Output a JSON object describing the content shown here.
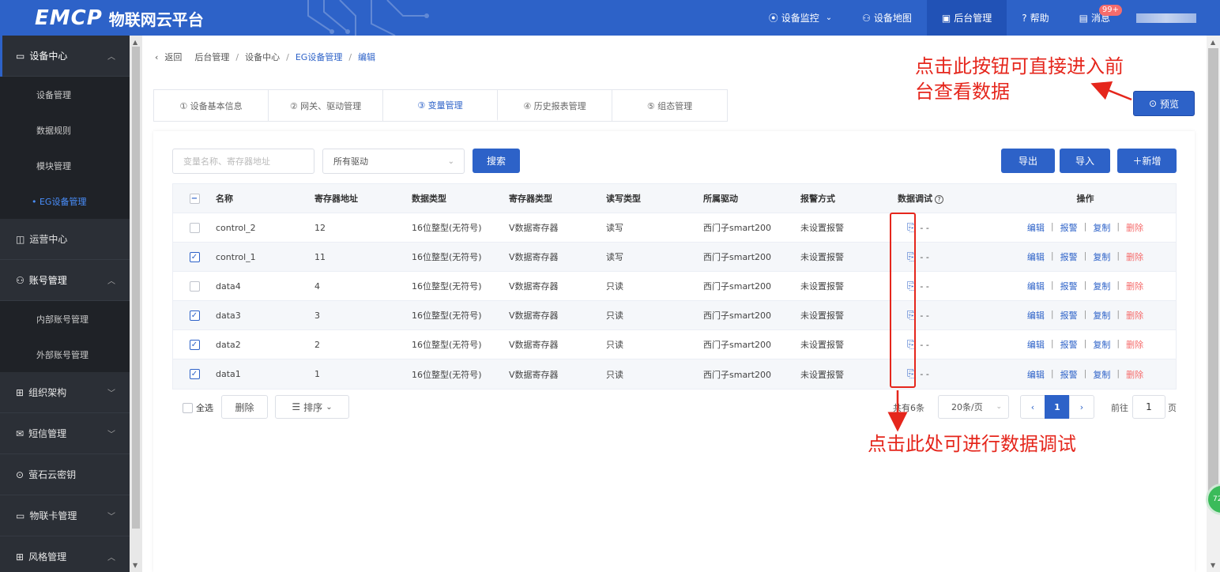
{
  "header": {
    "logo_mark": "EMCP",
    "logo_text": "物联网云平台",
    "nav": [
      {
        "icon": "location-icon",
        "label": "设备监控",
        "has_dropdown": true
      },
      {
        "icon": "user-icon",
        "label": "设备地图"
      },
      {
        "icon": "monitor-icon",
        "label": "后台管理",
        "active": true
      },
      {
        "icon": "help-icon",
        "label": "帮助"
      },
      {
        "icon": "message-icon",
        "label": "消息",
        "badge": "99+"
      }
    ]
  },
  "sidebar": {
    "groups": [
      {
        "label": "设备中心",
        "open": true,
        "items": [
          {
            "label": "设备管理"
          },
          {
            "label": "数据规则"
          },
          {
            "label": "模块管理"
          },
          {
            "label": "• EG设备管理",
            "active": true
          }
        ]
      },
      {
        "label": "运营中心"
      },
      {
        "label": "账号管理",
        "open": true,
        "items": [
          {
            "label": "内部账号管理"
          },
          {
            "label": "外部账号管理"
          }
        ]
      },
      {
        "label": "组织架构"
      },
      {
        "label": "短信管理"
      },
      {
        "label": "萤石云密钥"
      },
      {
        "label": "物联卡管理"
      },
      {
        "label": "风格管理"
      }
    ]
  },
  "breadcrumb": {
    "back": "返回",
    "items": [
      "后台管理",
      "设备中心",
      "EG设备管理",
      "编辑"
    ]
  },
  "tabs": [
    {
      "label": "① 设备基本信息"
    },
    {
      "label": "② 网关、驱动管理"
    },
    {
      "label": "③ 变量管理",
      "active": true
    },
    {
      "label": "④ 历史报表管理"
    },
    {
      "label": "⑤ 组态管理"
    }
  ],
  "preview_label": "预览",
  "toolbar": {
    "search_placeholder": "变量名称、寄存器地址",
    "driver_select": "所有驱动",
    "search_label": "搜索",
    "export_label": "导出",
    "import_label": "导入",
    "add_label": "＋新增"
  },
  "table": {
    "columns": [
      "名称",
      "寄存器地址",
      "数据类型",
      "寄存器类型",
      "读写类型",
      "所属驱动",
      "报警方式",
      "数据调试",
      "操作"
    ],
    "rows": [
      {
        "checked": false,
        "name": "control_2",
        "addr": "12",
        "dtype": "16位整型(无符号)",
        "rtype": "V数据寄存器",
        "rw": "读写",
        "driver": "西门子smart200",
        "alarm": "未设置报警",
        "debug": "- -"
      },
      {
        "checked": true,
        "name": "control_1",
        "addr": "11",
        "dtype": "16位整型(无符号)",
        "rtype": "V数据寄存器",
        "rw": "读写",
        "driver": "西门子smart200",
        "alarm": "未设置报警",
        "debug": "- -"
      },
      {
        "checked": false,
        "name": "data4",
        "addr": "4",
        "dtype": "16位整型(无符号)",
        "rtype": "V数据寄存器",
        "rw": "只读",
        "driver": "西门子smart200",
        "alarm": "未设置报警",
        "debug": "- -"
      },
      {
        "checked": true,
        "name": "data3",
        "addr": "3",
        "dtype": "16位整型(无符号)",
        "rtype": "V数据寄存器",
        "rw": "只读",
        "driver": "西门子smart200",
        "alarm": "未设置报警",
        "debug": "- -"
      },
      {
        "checked": true,
        "name": "data2",
        "addr": "2",
        "dtype": "16位整型(无符号)",
        "rtype": "V数据寄存器",
        "rw": "只读",
        "driver": "西门子smart200",
        "alarm": "未设置报警",
        "debug": "- -"
      },
      {
        "checked": true,
        "name": "data1",
        "addr": "1",
        "dtype": "16位整型(无符号)",
        "rtype": "V数据寄存器",
        "rw": "只读",
        "driver": "西门子smart200",
        "alarm": "未设置报警",
        "debug": "- -"
      }
    ],
    "ops": {
      "edit": "编辑",
      "alarm": "报警",
      "copy": "复制",
      "delete": "删除"
    }
  },
  "footer": {
    "select_all": "全选",
    "delete_label": "删除",
    "sort_label": "排序",
    "total": "共有6条",
    "page_size": "20条/页",
    "current_page": "1",
    "goto_label": "前往",
    "goto_value": "1",
    "goto_unit": "页"
  },
  "annotations": {
    "top": "点击此按钮可直接进入前台查看数据",
    "bottom": "点击此处可进行数据调试"
  },
  "float_ball": "72",
  "colors": {
    "primary": "#2d62c8",
    "danger": "#f56c6c",
    "annotation": "#e5261c",
    "sidebar": "#2b2f36"
  }
}
